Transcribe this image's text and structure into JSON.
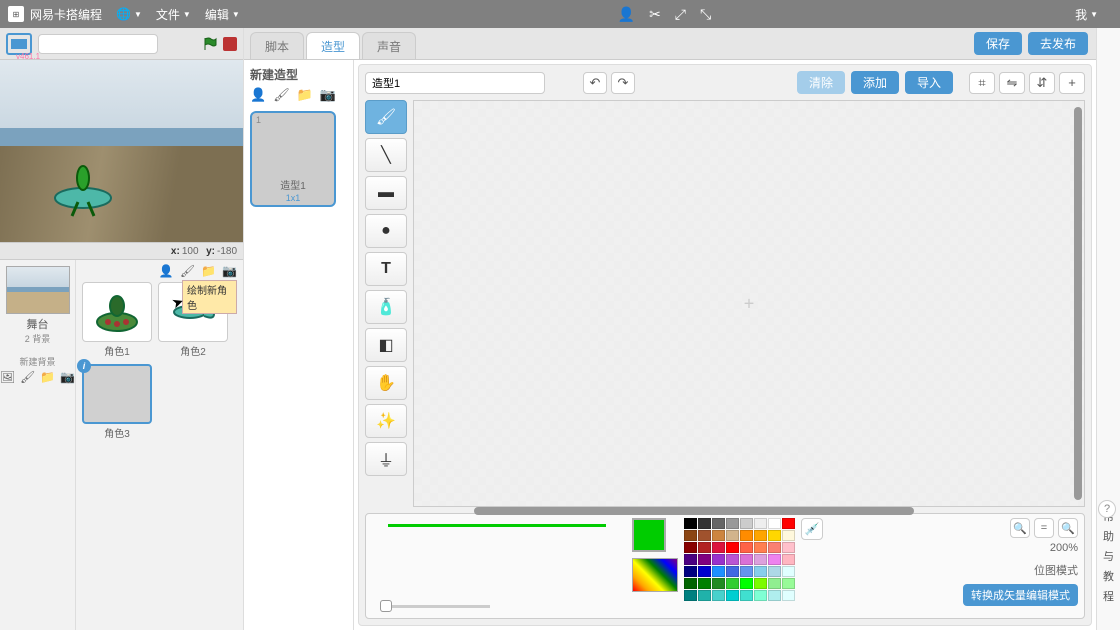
{
  "topbar": {
    "title": "网易卡搭编程",
    "file": "文件",
    "edit": "编辑",
    "user": "我"
  },
  "stage": {
    "version": "v461.1",
    "coords_x_label": "x:",
    "coords_x": "100",
    "coords_y_label": "y:",
    "coords_y": "-180"
  },
  "spritePanel": {
    "stage_label": "舞台",
    "backdrop_count": "2 背景",
    "new_backdrop": "新建背景",
    "tooltip": "绘制新角色",
    "sprites": [
      {
        "name": "角色1"
      },
      {
        "name": "角色2"
      },
      {
        "name": "角色3"
      }
    ]
  },
  "tabs": {
    "scripts": "脚本",
    "costumes": "造型",
    "sounds": "声音",
    "save": "保存",
    "publish": "去发布"
  },
  "costumes": {
    "new_label": "新建造型",
    "thumb": {
      "num": "1",
      "name": "造型1",
      "dim": "1x1"
    }
  },
  "paint": {
    "name_value": "造型1",
    "clear": "清除",
    "add": "添加",
    "import": "导入",
    "zoom": "200%",
    "mode": "位图模式",
    "mode_btn": "转换成矢量编辑模式"
  },
  "help": {
    "lines": [
      "帮",
      "助",
      "与",
      "教",
      "程"
    ]
  },
  "swatches": [
    "#000",
    "#333",
    "#666",
    "#999",
    "#ccc",
    "#eee",
    "#fff",
    "#f00",
    "#8b4513",
    "#a0522d",
    "#cd853f",
    "#d2b48c",
    "#ff8c00",
    "#ffa500",
    "#ffd700",
    "#fff8dc",
    "#800",
    "#b22222",
    "#dc143c",
    "#ff0000",
    "#ff6347",
    "#ff7f50",
    "#fa8072",
    "#ffc0cb",
    "#4b0082",
    "#800080",
    "#9932cc",
    "#ba55d3",
    "#da70d6",
    "#dda0dd",
    "#ee82ee",
    "#ffb6c1",
    "#000080",
    "#0000cd",
    "#1e90ff",
    "#4169e1",
    "#6495ed",
    "#87ceeb",
    "#add8e6",
    "#e0ffff",
    "#006400",
    "#008000",
    "#228b22",
    "#32cd32",
    "#00ff00",
    "#7cfc00",
    "#90ee90",
    "#98fb98",
    "#008080",
    "#20b2aa",
    "#48d1cc",
    "#00ced1",
    "#40e0d0",
    "#7fffd4",
    "#afeeee",
    "#e0ffff"
  ]
}
